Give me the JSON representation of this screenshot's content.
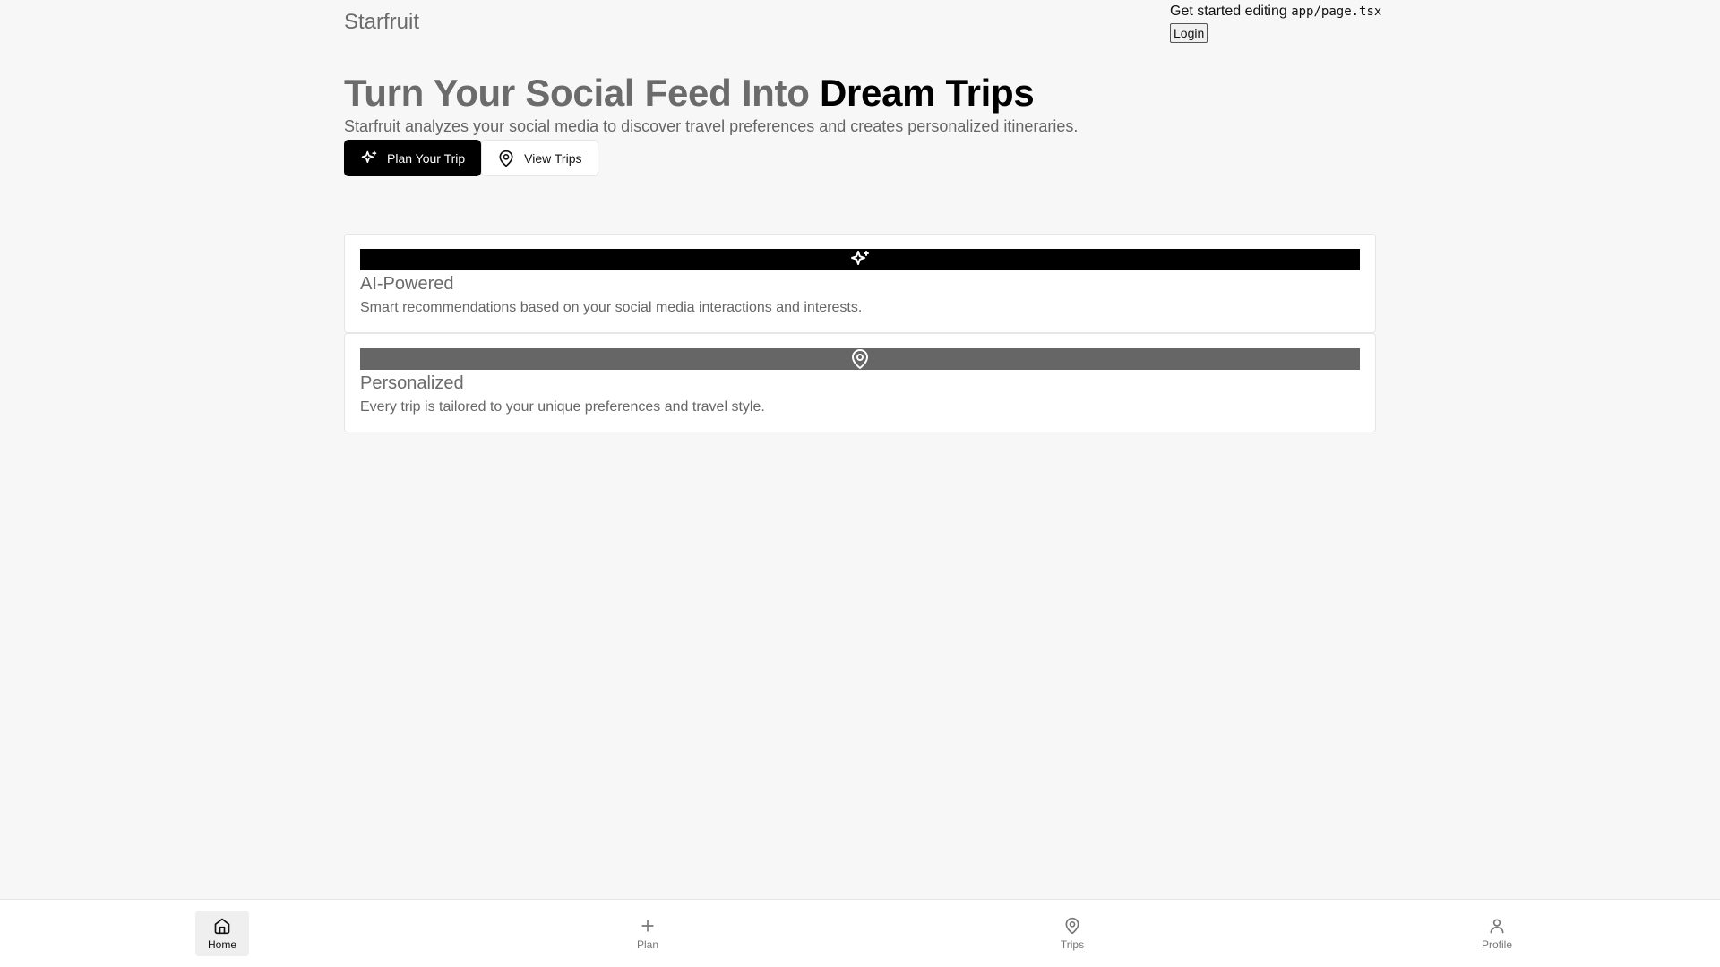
{
  "header": {
    "brand": "Starfruit",
    "edit_prefix": "Get started editing ",
    "edit_file": "app/page.tsx",
    "login_label": "Login"
  },
  "hero": {
    "title_muted": "Turn Your Social Feed Into ",
    "title_strong": "Dream Trips",
    "subtitle": "Starfruit analyzes your social media to discover travel preferences and creates personalized itineraries.",
    "plan_label": "Plan Your Trip",
    "view_label": "View Trips"
  },
  "features": [
    {
      "title": "AI-Powered",
      "description": "Smart recommendations based on your social media interactions and interests.",
      "icon": "sparkles-icon",
      "bar_color": "#000000"
    },
    {
      "title": "Personalized",
      "description": "Every trip is tailored to your unique preferences and travel style.",
      "icon": "map-pin-icon",
      "bar_color": "#666666"
    }
  ],
  "nav": {
    "items": [
      {
        "label": "Home",
        "icon": "home-icon",
        "active": true
      },
      {
        "label": "Plan",
        "icon": "plus-icon",
        "active": false
      },
      {
        "label": "Trips",
        "icon": "map-pin-icon",
        "active": false
      },
      {
        "label": "Profile",
        "icon": "user-icon",
        "active": false
      }
    ]
  },
  "colors": {
    "background": "#f7f7f7",
    "primary": "#000000",
    "muted_text": "#6b6b6b"
  }
}
